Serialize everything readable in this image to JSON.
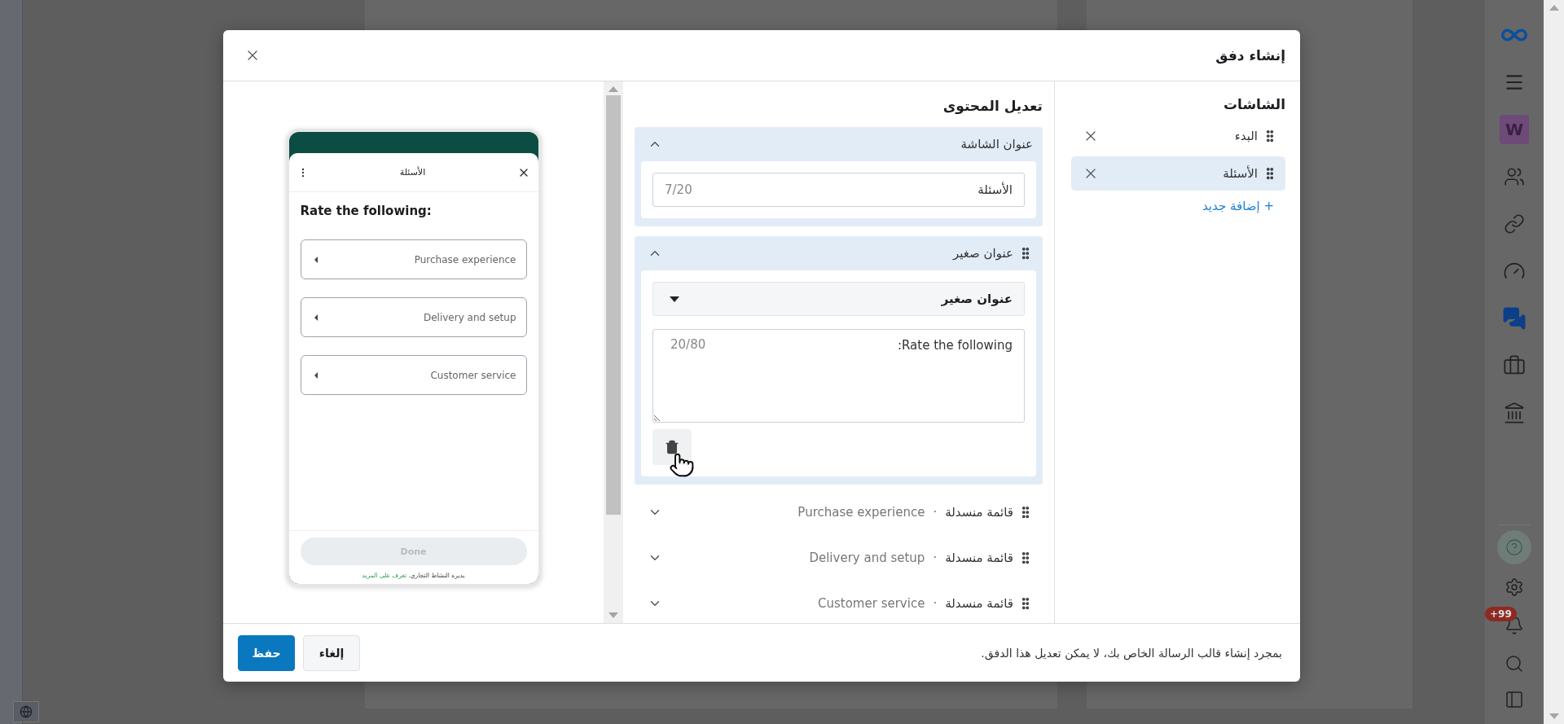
{
  "dialog": {
    "title": "إنشاء دفق"
  },
  "screens": {
    "heading": "الشاشات",
    "items": [
      {
        "label": "البدء",
        "selected": false
      },
      {
        "label": "الأسئلة",
        "selected": true
      }
    ],
    "add_link": "+ إضافة جديد"
  },
  "editor": {
    "heading": "تعديل المحتوى",
    "sections": [
      {
        "kind": "text_field",
        "title": "عنوان الشاشة",
        "expanded": true,
        "value": "الأسئلة",
        "counter": "7/20"
      },
      {
        "kind": "subheading",
        "title": "عنوان صغير",
        "expanded": true,
        "select": "عنوان صغير",
        "value": "Rate the following:",
        "counter": "20/80"
      },
      {
        "kind": "dropdown",
        "title": "قائمة منسدلة",
        "separator": "·",
        "detail": "Purchase experience",
        "expanded": false
      },
      {
        "kind": "dropdown",
        "title": "قائمة منسدلة",
        "separator": "·",
        "detail": "Delivery and setup",
        "expanded": false
      },
      {
        "kind": "dropdown",
        "title": "قائمة منسدلة",
        "separator": "·",
        "detail": "Customer service",
        "expanded": false
      }
    ]
  },
  "preview": {
    "title": "الأسئلة",
    "heading": "Rate the following:",
    "options": [
      "Purchase experience",
      "Delivery and setup",
      "Customer service"
    ],
    "button": "Done",
    "footer_text": "يديره النشاط التجاري.",
    "footer_link": "تعرف على المزيد"
  },
  "footer": {
    "note": "بمجرد إنشاء قالب الرسالة الخاص بك، لا يمكن تعديل هذا الدفق.",
    "buttons": [
      {
        "label": "إلغاء",
        "kind": "secondary"
      },
      {
        "label": "حفظ",
        "kind": "primary"
      }
    ]
  },
  "sidebar": {
    "avatar": "W",
    "badge": "+99"
  }
}
